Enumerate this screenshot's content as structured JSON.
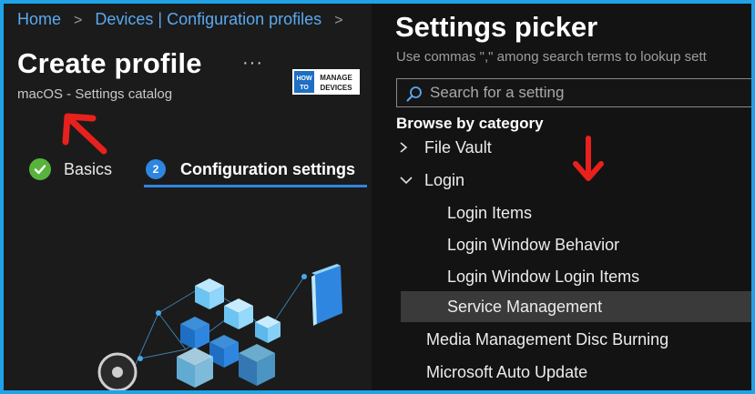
{
  "breadcrumb": {
    "items": [
      "Home",
      "Devices | Configuration profiles"
    ],
    "separator": ">"
  },
  "profile": {
    "title": "Create profile",
    "more": "···",
    "subtitle": "macOS - Settings catalog"
  },
  "logo": {
    "line1": "HOW",
    "line2": "TO",
    "line3": "MANAGE",
    "line4": "DEVICES"
  },
  "steps": [
    {
      "label": "Basics",
      "state": "complete"
    },
    {
      "label": "Configuration settings",
      "number": "2",
      "state": "active"
    }
  ],
  "picker": {
    "title": "Settings picker",
    "hint": "Use commas \",\" among search terms to lookup sett",
    "search_placeholder": "Search for a setting",
    "browse_label": "Browse by category",
    "categories": [
      {
        "label": "File Vault",
        "expanded": false
      },
      {
        "label": "Login",
        "expanded": true,
        "children": [
          "Login Items",
          "Login Window Behavior",
          "Login Window Login Items",
          "Service Management"
        ]
      },
      {
        "label": "Media Management Disc Burning"
      },
      {
        "label": "Microsoft Auto Update"
      }
    ],
    "selected": "Service Management"
  },
  "colors": {
    "frame": "#1fa3e6",
    "accent": "#2f86e0",
    "success": "#58b33c",
    "annotation_arrow": "#e8211d",
    "selected_row": "#3a3a3a"
  },
  "icons": {
    "step1": "checkmark-icon",
    "search": "search-icon",
    "collapsed": "chevron-right-icon",
    "expanded": "chevron-down-icon"
  }
}
